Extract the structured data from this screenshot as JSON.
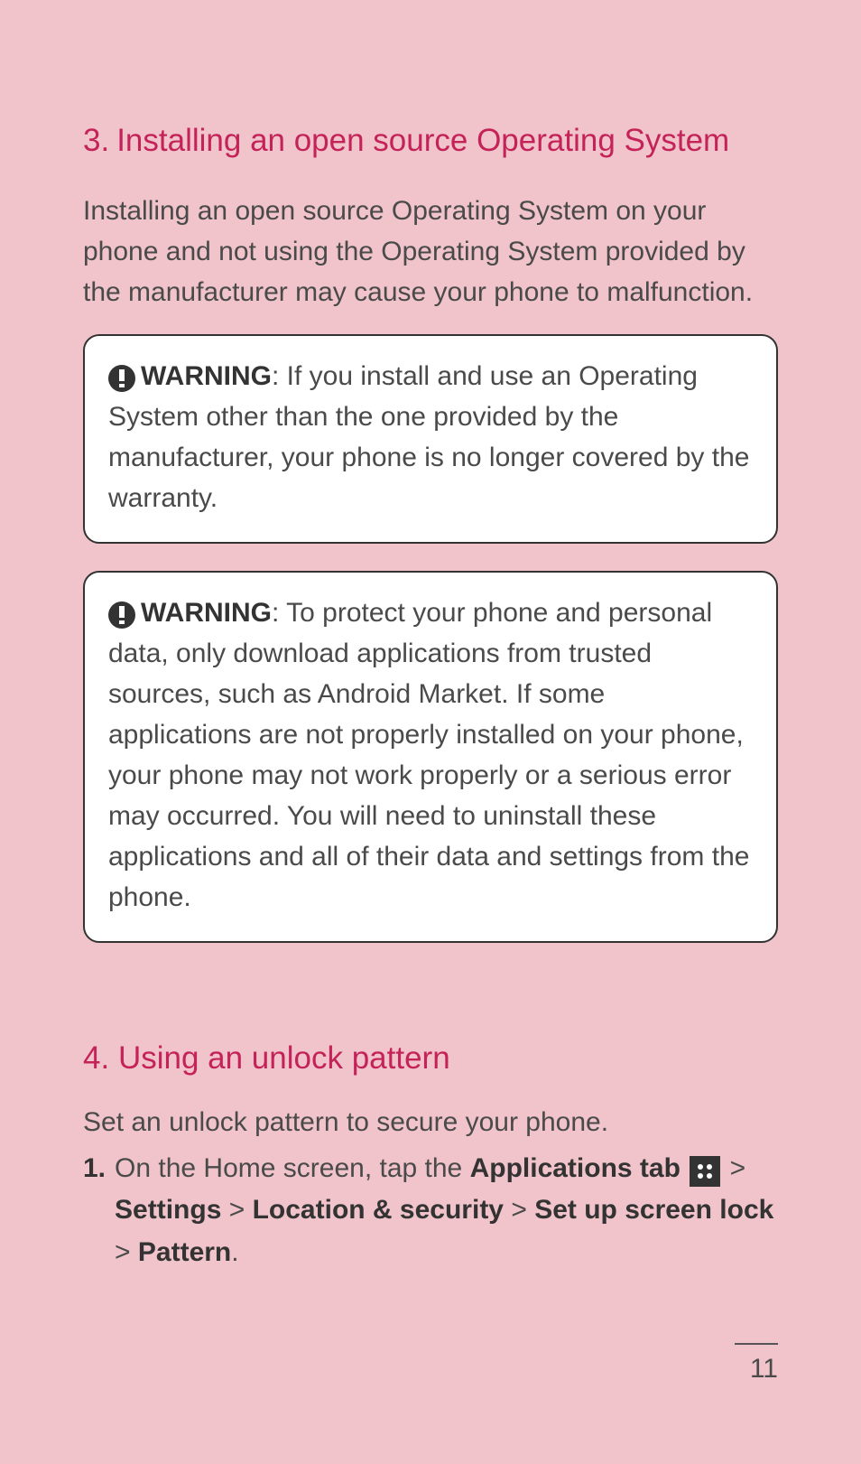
{
  "section3": {
    "number": "3.",
    "title": "Installing an open source Operating System",
    "intro": "Installing an open source Operating System on your phone and not using the Operating System provided by the manufacturer may cause your phone to malfunction."
  },
  "warning1": {
    "label": "WARNING",
    "text": ": If you install and use an Operating System other than the one provided by the manufacturer, your phone is no longer covered by the warranty."
  },
  "warning2": {
    "label": "WARNING",
    "text": ": To protect your phone and personal data, only download applications from trusted sources, such as Android Market.  If some applications are not properly installed on your phone, your phone may not work properly or a serious error may occurred. You will need to uninstall these applications and all of their data and settings from the phone."
  },
  "section4": {
    "number": "4.",
    "title": "Using an unlock pattern",
    "intro": "Set an unlock pattern to secure your phone."
  },
  "step1": {
    "number": "1.",
    "lead": "On the Home screen, tap the ",
    "apps_tab": "Applications tab",
    "sep": " > ",
    "settings": "Settings",
    "location": "Location & security",
    "setup": "Set up screen lock",
    "pattern": "Pattern",
    "period": "."
  },
  "page_number": "11"
}
